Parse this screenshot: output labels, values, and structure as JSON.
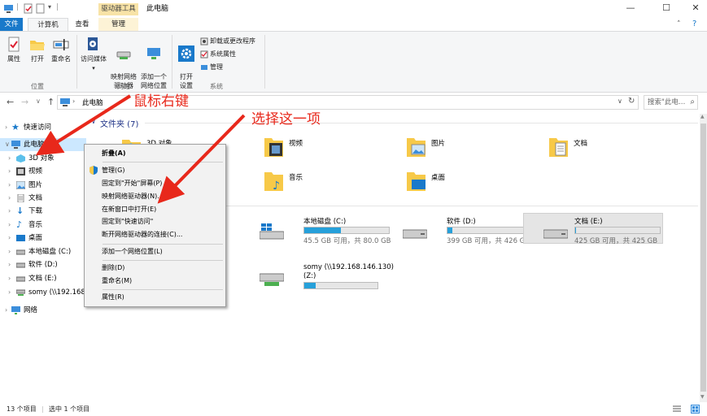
{
  "window": {
    "ribbon_context_header": "驱动器工具",
    "title": "此电脑",
    "minimize": "—",
    "maximize": "☐",
    "close": "✕"
  },
  "tabs": [
    {
      "label": "文件"
    },
    {
      "label": "计算机"
    },
    {
      "label": "查看"
    },
    {
      "label": "管理"
    }
  ],
  "ribbon": {
    "properties": "属性",
    "open": "打开",
    "rename": "重命名",
    "location_group": "位置",
    "access_media": "访问媒体",
    "map_drive": "映射网络\n驱动器",
    "add_location": "添加一个\n网络位置",
    "network_group": "网络",
    "open_settings": "打开\n设置",
    "uninstall": "卸载或更改程序",
    "sys_props": "系统属性",
    "manage": "管理",
    "system_group": "系统"
  },
  "address": {
    "path": "此电脑",
    "search_placeholder": "搜索\"此电…"
  },
  "nav": [
    {
      "label": "快速访问",
      "icon": "star-icon"
    },
    {
      "label": "此电脑",
      "icon": "computer-icon"
    },
    {
      "label": "3D 对象",
      "icon": "cube-icon"
    },
    {
      "label": "视频",
      "icon": "video-icon"
    },
    {
      "label": "图片",
      "icon": "picture-icon"
    },
    {
      "label": "文档",
      "icon": "document-icon"
    },
    {
      "label": "下载",
      "icon": "download-icon"
    },
    {
      "label": "音乐",
      "icon": "music-icon"
    },
    {
      "label": "桌面",
      "icon": "desktop-icon"
    },
    {
      "label": "本地磁盘 (C:)",
      "icon": "drive-icon"
    },
    {
      "label": "软件 (D:)",
      "icon": "drive-icon"
    },
    {
      "label": "文档 (E:)",
      "icon": "drive-icon"
    },
    {
      "label": "somy (\\\\192.168",
      "icon": "network-drive-icon"
    },
    {
      "label": "网络",
      "icon": "network-icon"
    }
  ],
  "content": {
    "folders_header": "文件夹 (7)",
    "folders": [
      {
        "label": "3D 对象"
      },
      {
        "label": "视频"
      },
      {
        "label": "图片"
      },
      {
        "label": "文档"
      },
      {
        "label": "音乐"
      },
      {
        "label": "桌面"
      }
    ],
    "drives": [
      {
        "name": "本地磁盘 (C:)",
        "info": "45.5 GB 可用，共 80.0 GB",
        "used_fraction": 0.43
      },
      {
        "name": "软件 (D:)",
        "info": "399 GB 可用，共 426 GB",
        "used_fraction": 0.06
      },
      {
        "name": "文档 (E:)",
        "info": "425 GB 可用，共 425 GB",
        "used_fraction": 0.01
      },
      {
        "name": "somy (\\\\192.168.146.130)",
        "name2": "(Z:)",
        "info": "",
        "used_fraction": 0.15
      }
    ]
  },
  "context_menu": [
    "折叠(A)",
    "管理(G)",
    "固定到\"开始\"屏幕(P)",
    "映射网络驱动器(N)...",
    "在新窗口中打开(E)",
    "固定到\"快速访问\"",
    "断开网络驱动器的连接(C)...",
    "添加一个网络位置(L)",
    "删除(D)",
    "重命名(M)",
    "属性(R)"
  ],
  "annotations": {
    "right_click": "鼠标右键",
    "choose_this": "选择这一项"
  },
  "status": {
    "items": "13 个项目",
    "selected": "选中 1 个项目"
  },
  "colors": {
    "accent": "#1979ca",
    "annotation": "#e8281b",
    "selection": "#cce8ff",
    "drive_bar": "#26a0da"
  }
}
